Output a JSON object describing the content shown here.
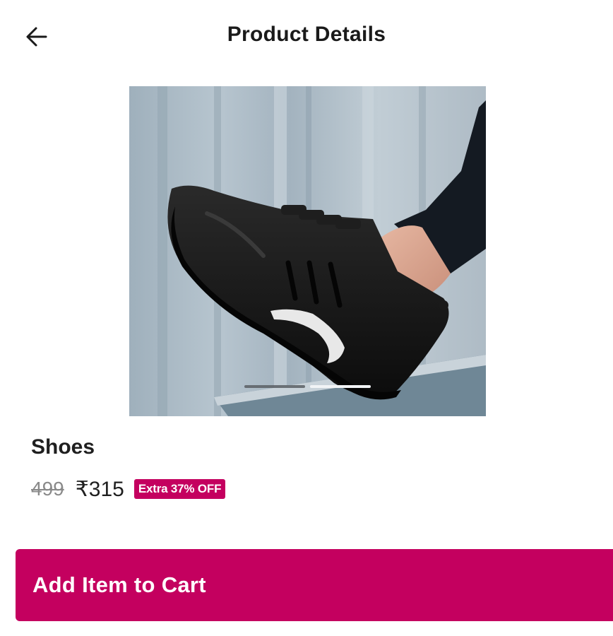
{
  "header": {
    "title": "Product Details",
    "back_icon": "arrow-left-icon"
  },
  "carousel": {
    "image_label": "black sneaker on foot against grey wall",
    "slide_count": 2,
    "active_slide": 2
  },
  "product": {
    "name": "Shoes",
    "original_price": "499",
    "price": "₹315",
    "discount_badge": "Extra 37% OFF"
  },
  "cta": {
    "label": "Add Item to Cart"
  },
  "colors": {
    "accent": "#c4005f",
    "text": "#1a1a1a",
    "muted": "#8a8a8a"
  }
}
